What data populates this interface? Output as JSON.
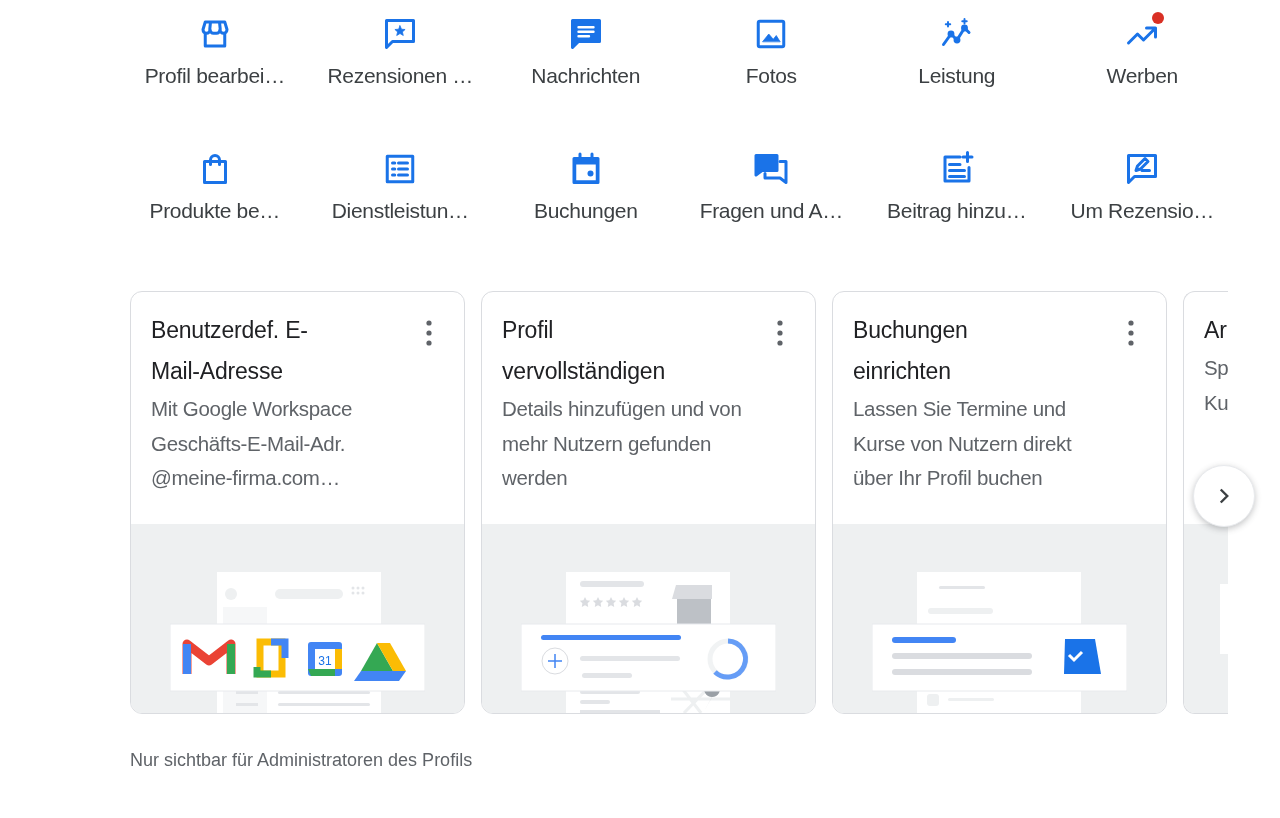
{
  "actions": [
    {
      "label": "Profil bearbei…",
      "notification": false
    },
    {
      "label": "Rezensionen …",
      "notification": false
    },
    {
      "label": "Nachrichten",
      "notification": false
    },
    {
      "label": "Fotos",
      "notification": false
    },
    {
      "label": "Leistung",
      "notification": false
    },
    {
      "label": "Werben",
      "notification": true
    },
    {
      "label": "Produkte be…",
      "notification": false
    },
    {
      "label": "Dienstleistun…",
      "notification": false
    },
    {
      "label": "Buchungen",
      "notification": false
    },
    {
      "label": "Fragen und A…",
      "notification": false
    },
    {
      "label": "Beitrag hinzu…",
      "notification": false
    },
    {
      "label": "Um Rezensio…",
      "notification": false
    }
  ],
  "cards": [
    {
      "kind": "workspace",
      "title": "Benutzerdef. E-Mail-Adresse",
      "description": "Mit Google Workspace Geschäfts-E-Mail-Adr. @meine-firma.com…",
      "calendar_day": "31"
    },
    {
      "kind": "profile",
      "title": "Profil vervollständigen",
      "description": "Details hinzufügen und von mehr Nutzern gefunden werden"
    },
    {
      "kind": "booking",
      "title": "Buchungen einrichten",
      "description": "Lassen Sie Termine und Kurse von Nutzern direkt über Ihr Profil buchen"
    },
    {
      "kind": "partial",
      "title": "Ar",
      "description": "Sp Ku"
    }
  ],
  "footer": "Nur sichtbar für Administratoren des Profils"
}
